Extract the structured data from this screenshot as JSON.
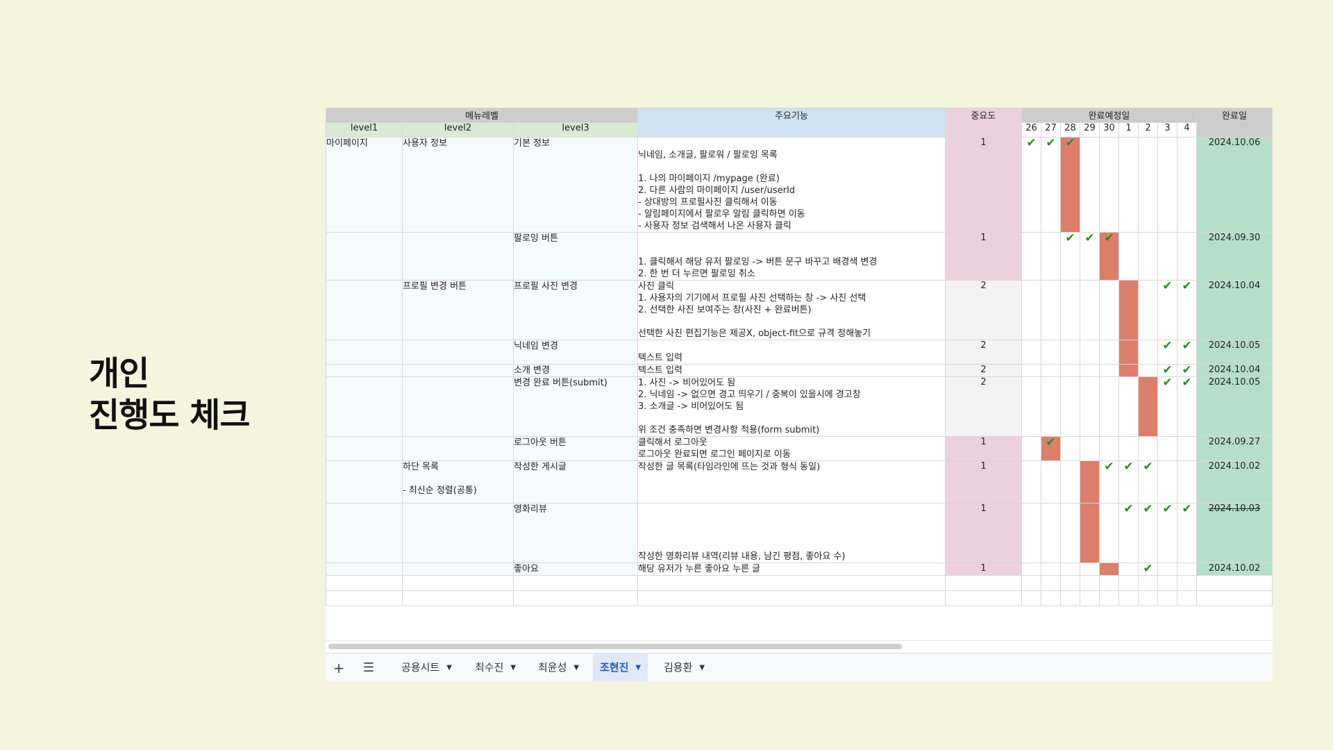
{
  "slide_title": {
    "line1": "개인",
    "line2": "진행도 체크"
  },
  "headers": {
    "menu_level": "메뉴레벨",
    "level1": "level1",
    "level2": "level2",
    "level3": "level3",
    "main_features": "주요기능",
    "importance": "중요도",
    "planned_dates": "완료예정일",
    "completed_date": "완료일",
    "days": [
      "26",
      "27",
      "28",
      "29",
      "30",
      "1",
      "2",
      "3",
      "4"
    ]
  },
  "rows": [
    {
      "level1": "마이페이지",
      "level2": "사용자 정보",
      "level3": "기본 정보",
      "feature": "\n닉네임, 소개글, 팔로워 / 팔로잉 목록\n\n1. 나의 마이페이지 /mypage (완료)\n2. 다른 사람의 마이페이지 /user/userId\n    - 상대방의 프로필사진 클릭해서 이동\n    - 알림페이지에서 팔로우 알림 클릭하면 이동\n    - 사용자 정보 검색해서 나온 사용자 클릭",
      "importance": "1",
      "imp_color": "pink",
      "done": "2024.10.06",
      "struck": false
    },
    {
      "level1": "",
      "level2": "",
      "level3": "팔로잉 버튼",
      "feature": "\n\n1. 클릭해서 해당 유저 팔로잉 -> 버튼 문구 바꾸고 배경색 변경\n2. 한 번 더 누르면 팔로잉 취소",
      "importance": "1",
      "imp_color": "pink",
      "done": "2024.09.30",
      "struck": false
    },
    {
      "level1": "",
      "level2": "프로필 변경 버튼",
      "level3": "프로필 사진 변경",
      "feature": "사진 클릭\n1. 사용자의 기기에서 프로필 사진 선택하는 창 -> 사진 선택\n2. 선택한 사진 보여주는 창(사진 + 완료버튼)\n\n선택한 사진 편집기능은 제공X, object-fit으로 규격 정해놓기",
      "importance": "2",
      "imp_color": "grey",
      "done": "2024.10.04",
      "struck": false
    },
    {
      "level1": "",
      "level2": "",
      "level3": "닉네임 변경",
      "feature": "\n텍스트 입력",
      "importance": "2",
      "imp_color": "grey",
      "done": "2024.10.05",
      "struck": false
    },
    {
      "level1": "",
      "level2": "",
      "level3": "소개 변경",
      "feature": "텍스트 입력",
      "importance": "2",
      "imp_color": "grey",
      "done": "2024.10.04",
      "struck": false
    },
    {
      "level1": "",
      "level2": "",
      "level3": "변경 완료 버튼(submit)",
      "feature": "1. 사진 -> 비어있어도 됨\n2. 닉네임 -> 없으면 경고 띄우기 / 중복이 있을시에 경고창\n3. 소개글 -> 비어있어도 됨\n\n위 조건 충족하면 변경사항 적용(form submit)",
      "importance": "2",
      "imp_color": "grey",
      "done": "2024.10.05",
      "struck": false
    },
    {
      "level1": "",
      "level2": "",
      "level3": "로그아웃 버튼",
      "feature": "클릭해서 로그아웃\n로그아웃 완료되면 로그인 페이지로 이동",
      "importance": "1",
      "imp_color": "pink",
      "done": "2024.09.27",
      "struck": false
    },
    {
      "level1": "",
      "level2": "하단 목록\n\n- 최신순 정렬(공통)",
      "level3": "작성한 게시글",
      "feature": "작성한 글 목록(타임라인에 뜨는 것과 형식 동일)",
      "importance": "1",
      "imp_color": "pink",
      "done": "2024.10.02",
      "struck": false
    },
    {
      "level1": "",
      "level2": "",
      "level3": "영화리뷰",
      "feature": "\n\n\n\n작성한 영화리뷰 내역(리뷰 내용, 남긴 평점, 좋아요 수)",
      "importance": "1",
      "imp_color": "pink",
      "done": "2024.10.03",
      "struck": true
    },
    {
      "level1": "",
      "level2": "",
      "level3": "좋아요",
      "feature": "해당 유저가 누른 좋아요 누른 글",
      "importance": "1",
      "imp_color": "pink",
      "done": "2024.10.02",
      "struck": false
    }
  ],
  "gantt": {
    "bars": [
      [
        2
      ],
      [
        4
      ],
      [
        5
      ],
      [
        5
      ],
      [
        5
      ],
      [
        6
      ],
      [
        1
      ],
      [
        3
      ],
      [
        3
      ],
      [
        4
      ]
    ],
    "checks": [
      [
        0,
        1,
        2
      ],
      [
        2,
        3,
        4
      ],
      [
        7,
        8
      ],
      [
        7,
        8
      ],
      [
        7,
        8
      ],
      [
        7,
        8
      ],
      [
        1
      ],
      [
        4,
        5,
        6
      ],
      [
        5,
        6,
        7,
        8
      ],
      [
        6
      ]
    ]
  },
  "tabs": {
    "add_icon": "plus-icon",
    "list_icon": "menu-icon",
    "items": [
      {
        "label": "공용시트",
        "active": false
      },
      {
        "label": "최수진",
        "active": false
      },
      {
        "label": "최윤성",
        "active": false
      },
      {
        "label": "조현진",
        "active": true
      },
      {
        "label": "김용환",
        "active": false
      }
    ]
  },
  "colors": {
    "bar": "#dd7e6b",
    "done_bg": "#b6dfca",
    "importance_pink": "#ead1dc",
    "header_green": "#d9ead3",
    "header_blue": "#cfe2f3",
    "check": "#2a8a2a"
  }
}
